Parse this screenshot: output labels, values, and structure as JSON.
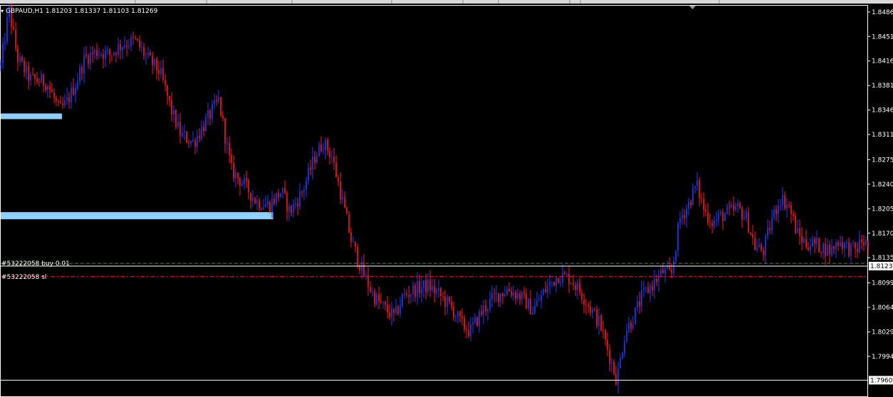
{
  "colors": {
    "background": "#000000",
    "bull": "#1f3cff",
    "bear": "#ff1a1a",
    "frame": "#ffffff",
    "zone": "#8fd0ff",
    "buy_line": "#3c8c3c",
    "sl_line": "#ff2020"
  },
  "header": {
    "symbol_text": "GBPAUD,H1  1.81203 1.81337 1.81103 1.81269"
  },
  "orders": {
    "buy_label": "#53222058 buy 0.01",
    "sl_label": "#53222058 sl"
  },
  "current_price_label": "1.8123",
  "bottom_price_label": "1.7960",
  "chart_data": {
    "type": "candlestick",
    "title": "GBPAUD,H1",
    "ohlc_header": [
      1.81203,
      1.81337,
      1.81103,
      1.81269
    ],
    "ylim": [
      1.7937,
      1.8495
    ],
    "y_ticks": [
      "1.8486",
      "1.8451",
      "1.8416",
      "1.8381",
      "1.8346",
      "1.8311",
      "1.8275",
      "1.8240",
      "1.8205",
      "1.8170",
      "1.8135",
      "1.8099",
      "1.8064",
      "1.8029",
      "1.7994"
    ],
    "y_tick_values": [
      1.8486,
      1.8451,
      1.8416,
      1.8381,
      1.8346,
      1.8311,
      1.8275,
      1.824,
      1.8205,
      1.817,
      1.8135,
      1.8099,
      1.8064,
      1.8029,
      1.7994
    ],
    "current_price": 1.8123,
    "bottom_price": 1.796,
    "buy_price": 1.8127,
    "sl_price": 1.8108,
    "zones": [
      {
        "x_start": 0,
        "x_end": 0.073,
        "price": 1.8337
      },
      {
        "x_start": 0,
        "x_end": 0.325,
        "price": 1.8195
      }
    ],
    "anchors": [
      [
        0.0,
        1.841
      ],
      [
        0.01,
        1.849
      ],
      [
        0.02,
        1.842
      ],
      [
        0.035,
        1.839
      ],
      [
        0.055,
        1.8385
      ],
      [
        0.07,
        1.8345
      ],
      [
        0.078,
        1.8355
      ],
      [
        0.09,
        1.8385
      ],
      [
        0.1,
        1.842
      ],
      [
        0.115,
        1.843
      ],
      [
        0.13,
        1.8425
      ],
      [
        0.145,
        1.844
      ],
      [
        0.16,
        1.8445
      ],
      [
        0.175,
        1.842
      ],
      [
        0.19,
        1.84
      ],
      [
        0.205,
        1.834
      ],
      [
        0.215,
        1.831
      ],
      [
        0.23,
        1.83
      ],
      [
        0.245,
        1.833
      ],
      [
        0.26,
        1.836
      ],
      [
        0.275,
        1.826
      ],
      [
        0.29,
        1.824
      ],
      [
        0.305,
        1.8215
      ],
      [
        0.32,
        1.821
      ],
      [
        0.335,
        1.823
      ],
      [
        0.345,
        1.82
      ],
      [
        0.36,
        1.823
      ],
      [
        0.375,
        1.828
      ],
      [
        0.385,
        1.83
      ],
      [
        0.395,
        1.828
      ],
      [
        0.405,
        1.823
      ],
      [
        0.418,
        1.816
      ],
      [
        0.43,
        1.812
      ],
      [
        0.445,
        1.808
      ],
      [
        0.46,
        1.806
      ],
      [
        0.47,
        1.805
      ],
      [
        0.48,
        1.808
      ],
      [
        0.495,
        1.809
      ],
      [
        0.51,
        1.8095
      ],
      [
        0.525,
        1.808
      ],
      [
        0.54,
        1.806
      ],
      [
        0.55,
        1.804
      ],
      [
        0.56,
        1.803
      ],
      [
        0.575,
        1.806
      ],
      [
        0.59,
        1.808
      ],
      [
        0.605,
        1.809
      ],
      [
        0.62,
        1.808
      ],
      [
        0.635,
        1.806
      ],
      [
        0.65,
        1.809
      ],
      [
        0.665,
        1.811
      ],
      [
        0.68,
        1.8105
      ],
      [
        0.695,
        1.808
      ],
      [
        0.705,
        1.806
      ],
      [
        0.715,
        1.804
      ],
      [
        0.725,
        1.8
      ],
      [
        0.735,
        1.796
      ],
      [
        0.745,
        1.803
      ],
      [
        0.755,
        1.805
      ],
      [
        0.765,
        1.808
      ],
      [
        0.78,
        1.81
      ],
      [
        0.79,
        1.8115
      ],
      [
        0.8,
        1.811
      ],
      [
        0.81,
        1.819
      ],
      [
        0.82,
        1.821
      ],
      [
        0.83,
        1.824
      ],
      [
        0.84,
        1.82
      ],
      [
        0.85,
        1.8185
      ],
      [
        0.86,
        1.8195
      ],
      [
        0.87,
        1.82
      ],
      [
        0.88,
        1.8205
      ],
      [
        0.89,
        1.819
      ],
      [
        0.9,
        1.815
      ],
      [
        0.91,
        1.8145
      ],
      [
        0.92,
        1.819
      ],
      [
        0.93,
        1.822
      ],
      [
        0.94,
        1.821
      ],
      [
        0.95,
        1.817
      ],
      [
        0.96,
        1.8155
      ],
      [
        0.97,
        1.8155
      ],
      [
        0.98,
        1.815
      ],
      [
        0.99,
        1.8145
      ],
      [
        1.0,
        1.816
      ],
      [
        1.01,
        1.815
      ],
      [
        1.02,
        1.8145
      ],
      [
        1.028,
        1.816
      ],
      [
        1.035,
        1.815
      ]
    ],
    "last_close": 1.81269
  }
}
